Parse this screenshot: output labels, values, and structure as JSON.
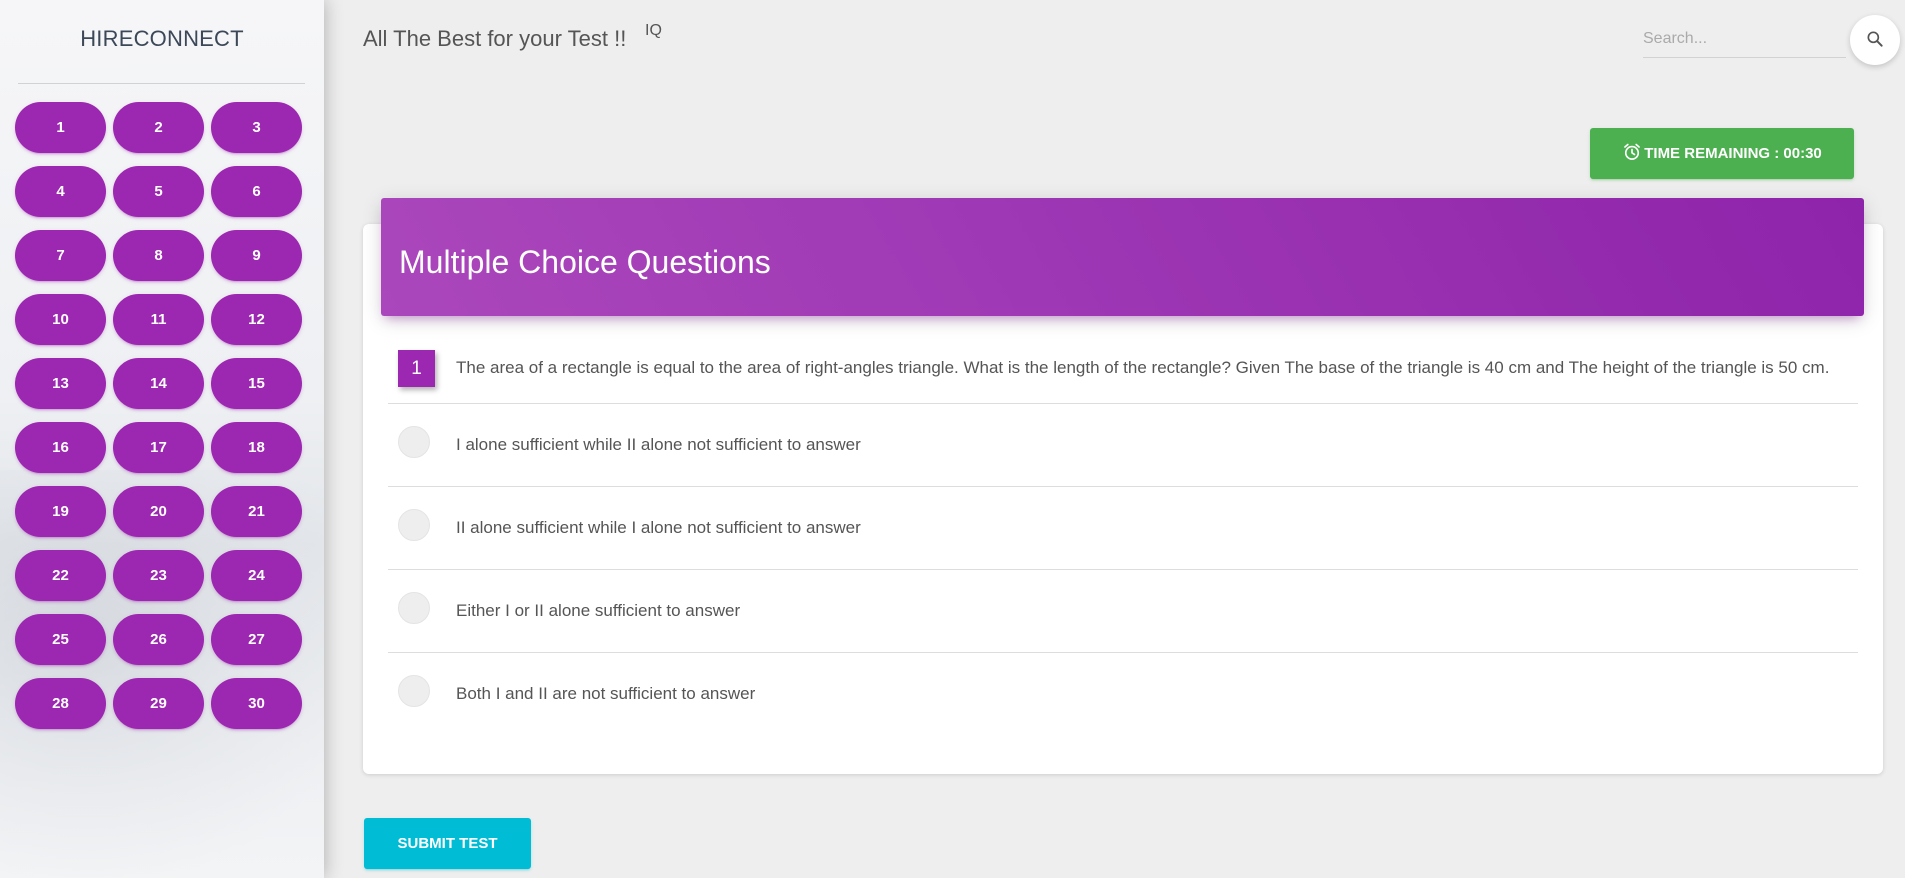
{
  "sidebar": {
    "brand": "HIRECONNECT",
    "question_numbers": [
      "1",
      "2",
      "3",
      "4",
      "5",
      "6",
      "7",
      "8",
      "9",
      "10",
      "11",
      "12",
      "13",
      "14",
      "15",
      "16",
      "17",
      "18",
      "19",
      "20",
      "21",
      "22",
      "23",
      "24",
      "25",
      "26",
      "27",
      "28",
      "29",
      "30"
    ]
  },
  "header": {
    "title": "All The Best for your Test !!",
    "subtitle": "IQ",
    "search": {
      "placeholder": "Search...",
      "icon": "search-icon"
    }
  },
  "timer": {
    "icon": "alarm-clock-icon",
    "label": "TIME REMAINING : 00:30",
    "color": "#4caf50"
  },
  "card": {
    "title": "Multiple Choice Questions",
    "question": {
      "number": "1",
      "text": "The area of a rectangle is equal to the area of right-angles triangle. What is the length of the rectangle? Given The base of the triangle is 40 cm and The height of the triangle is 50 cm."
    },
    "options": [
      "I alone sufficient while II alone not sufficient to answer",
      "II alone sufficient while I alone not sufficient to answer",
      "Either I or II alone sufficient to answer",
      "Both I and II are not sufficient to answer"
    ]
  },
  "submit_label": "SUBMIT TEST",
  "colors": {
    "accent": "#9c27b0",
    "submit": "#00bcd4",
    "background": "#eeeeee"
  }
}
